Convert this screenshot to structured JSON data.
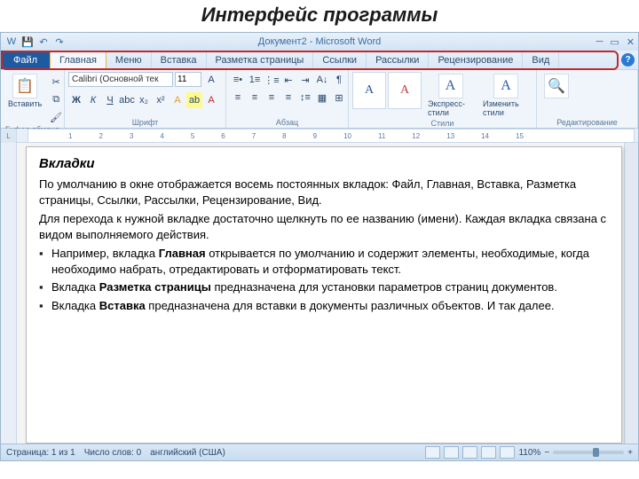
{
  "slide_title": "Интерфейс программы",
  "window_title": "Документ2 - Microsoft Word",
  "tabs": {
    "file": "Файл",
    "items": [
      "Главная",
      "Меню",
      "Вставка",
      "Разметка страницы",
      "Ссылки",
      "Рассылки",
      "Рецензирование",
      "Вид"
    ]
  },
  "qat_icons": [
    "W",
    "💾",
    "↶",
    "↷"
  ],
  "ribbon": {
    "clipboard": {
      "label": "Буфер обмена",
      "paste": "Вставить"
    },
    "font": {
      "label": "Шрифт",
      "name": "Calibri (Основной тек",
      "size": "11"
    },
    "paragraph": {
      "label": "Абзац"
    },
    "styles": {
      "label": "Стили",
      "express": "Экспресс-стили",
      "change": "Изменить стили"
    },
    "editing": {
      "label": "Редактирование"
    }
  },
  "ruler_numbers": [
    "1",
    "2",
    "3",
    "4",
    "5",
    "6",
    "7",
    "8",
    "9",
    "10",
    "11",
    "12",
    "13",
    "14",
    "15"
  ],
  "doc": {
    "heading": "Вкладки",
    "p1": "По умолчанию в окне отображается восемь постоянных вкладок: Файл,   Главная,   Вставка,   Разметка страницы,   Ссылки,   Рассылки,   Рецензирование,   Вид.",
    "p2": "Для перехода к нужной вкладке достаточно щелкнуть по ее названию (имени). Каждая вкладка связана с видом выполняемого действия.",
    "li1a": "Например, вкладка ",
    "li1b": "Главная",
    "li1c": " открывается по умолчанию  и содержит элементы, необходимые, когда необходимо набрать, отредактировать и отформатировать текст.",
    "li2a": "Вкладка ",
    "li2b": "Разметка страницы",
    "li2c": " предназначена для установки параметров страниц документов.",
    "li3a": " Вкладка ",
    "li3b": "Вставка",
    "li3c": " предназначена для вставки в документы различных объектов. И так далее."
  },
  "status": {
    "page": "Страница: 1 из 1",
    "words": "Число слов: 0",
    "lang": "английский (США)",
    "zoom": "110%"
  }
}
